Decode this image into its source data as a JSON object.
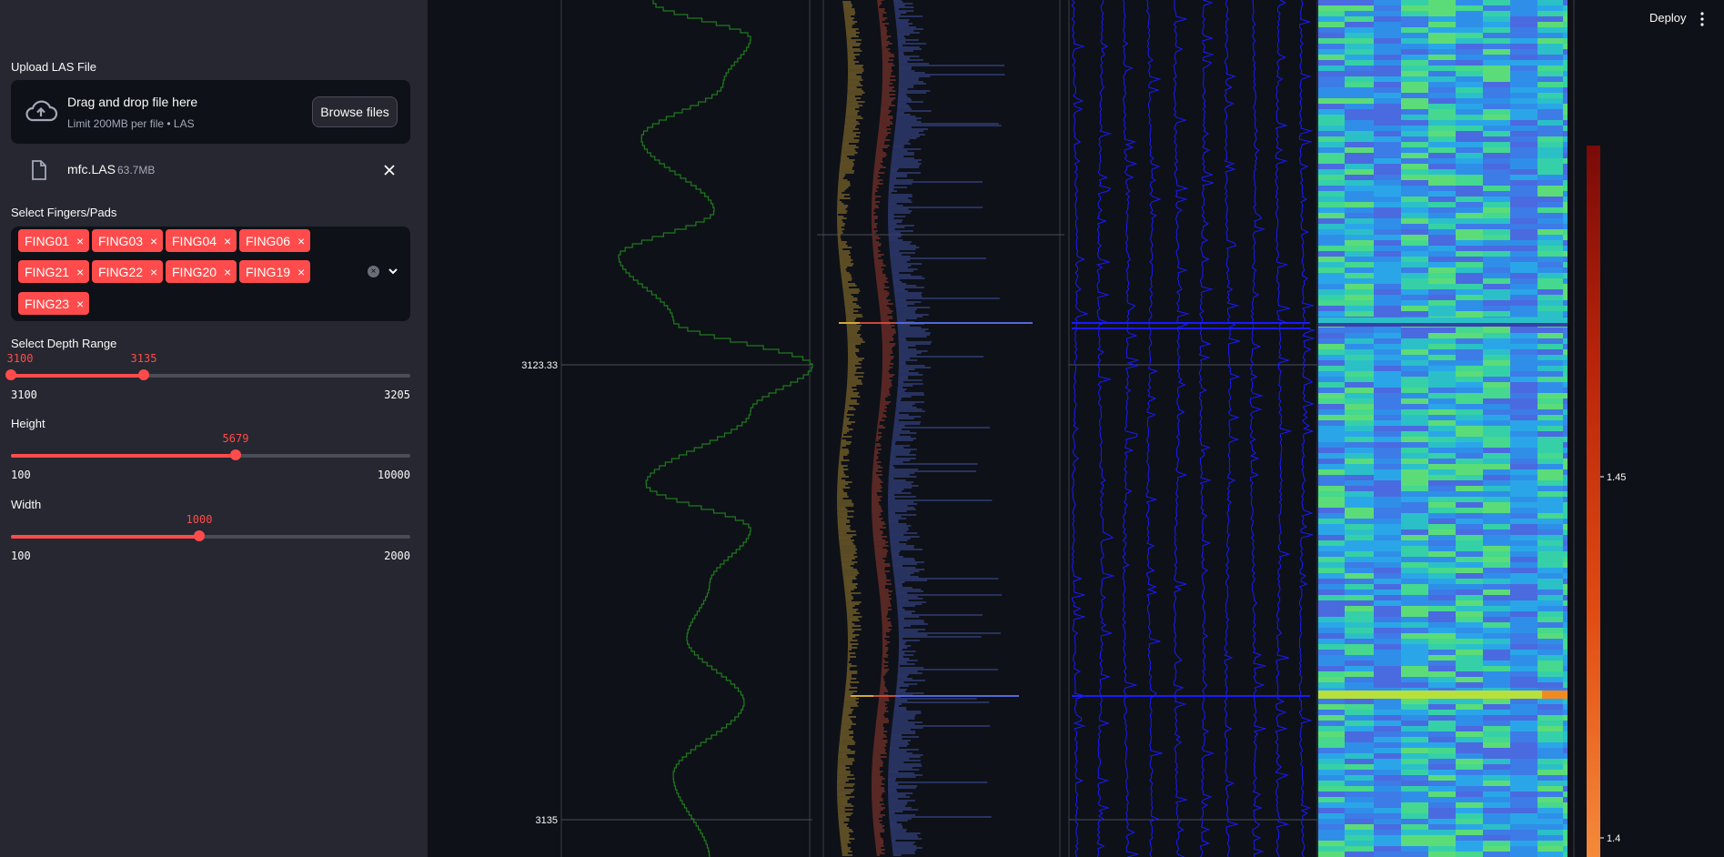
{
  "header": {
    "deploy_label": "Deploy",
    "menu_icon": "kebab-menu-icon"
  },
  "sidebar": {
    "upload": {
      "label": "Upload LAS File",
      "drop_text": "Drag and drop file here",
      "limit_text": "Limit 200MB per file • LAS",
      "browse_label": "Browse files",
      "file": {
        "name": "mfc.LAS",
        "size": "63.7MB"
      }
    },
    "fingers": {
      "label": "Select Fingers/Pads",
      "selected": [
        "FING01",
        "FING03",
        "FING04",
        "FING06",
        "FING21",
        "FING22",
        "FING20",
        "FING19",
        "FING23"
      ]
    },
    "depth_range": {
      "label": "Select Depth Range",
      "low": 3100,
      "high": 3135,
      "min": 3100,
      "max": 3205
    },
    "height": {
      "label": "Height",
      "value": 5679,
      "min": 100,
      "max": 10000
    },
    "width": {
      "label": "Width",
      "value": 1000,
      "min": 100,
      "max": 2000
    }
  },
  "plot": {
    "depth_ticks": [
      "3123.33",
      "3135"
    ],
    "colorbar_ticks": [
      "1.45",
      "1.4"
    ],
    "colors": {
      "accent": "#ff4b4b",
      "green_curve": "#1f7a1f",
      "gold": "#d4a83a",
      "red": "#c84a3a",
      "blue": "#5468d8",
      "navy": "#1a1aff"
    }
  },
  "chart_data": {
    "type": "line",
    "title": "",
    "ylabel": "",
    "y_ticks": [
      3123.33,
      3135
    ],
    "tracks": [
      "green curve track",
      "finger overlay track (gold/red/blue)",
      "finger profile track (blue)",
      "heatmap track"
    ],
    "colorbar": {
      "ticks": [
        1.45,
        1.4
      ],
      "colormap": "Oranges-Reds"
    }
  }
}
